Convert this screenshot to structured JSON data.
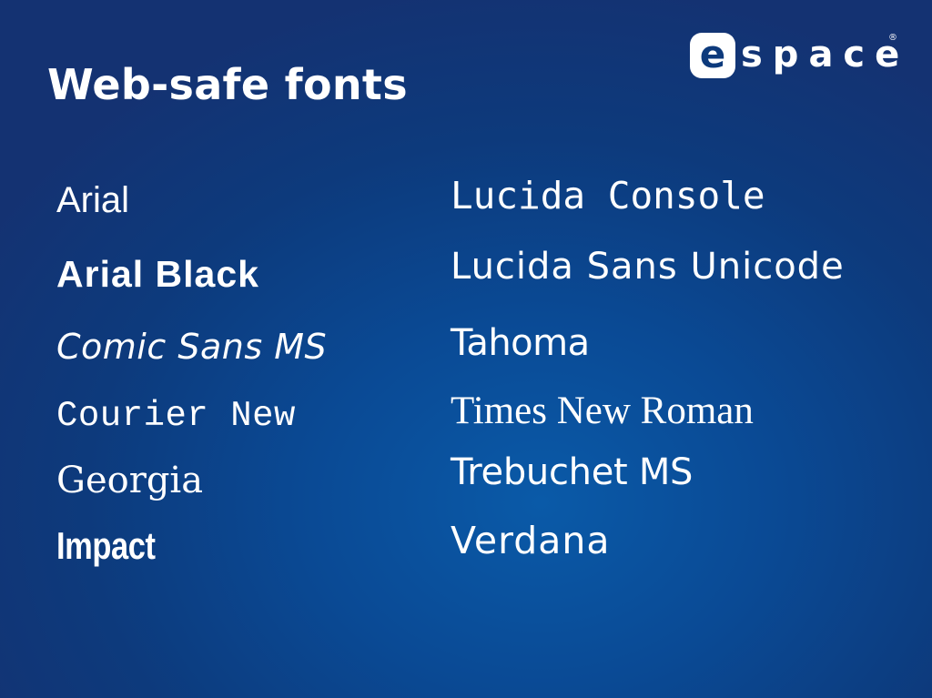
{
  "slide": {
    "title": "Web-safe fonts",
    "background_color": "#0d3a7c",
    "text_color": "#ffffff"
  },
  "logo": {
    "letter": "e",
    "rest": "space",
    "registered_mark": "®"
  },
  "fonts": {
    "left_column": [
      "Arial",
      "Arial Black",
      "Comic Sans MS",
      "Courier New",
      "Georgia",
      "Impact"
    ],
    "right_column": [
      "Lucida Console",
      "Lucida Sans Unicode",
      "Tahoma",
      "Times New Roman",
      "Trebuchet MS",
      "Verdana"
    ]
  }
}
